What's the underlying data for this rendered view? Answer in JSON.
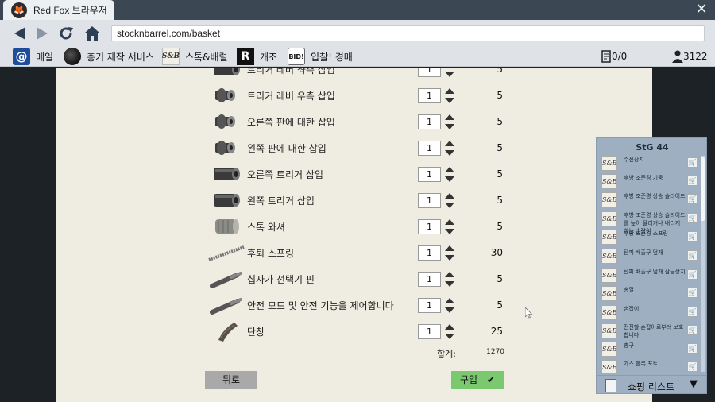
{
  "browser": {
    "tab_title": "Red Fox 브라우저",
    "url": "stocknbarrel.com/basket"
  },
  "bookmarks": [
    {
      "label": "메일",
      "icon": "mail-icon",
      "glyph": "@"
    },
    {
      "label": "총기 제작 서비스",
      "icon": "gun-sphere-icon",
      "glyph": ""
    },
    {
      "label": "스톡&배럴",
      "icon": "stock-and-barrel-logo",
      "glyph": "S&B"
    },
    {
      "label": "개조",
      "icon": "r-logo-icon",
      "glyph": "R"
    },
    {
      "label": "입찰! 경매",
      "icon": "bid-logo-icon",
      "glyph": "BID!"
    }
  ],
  "status": {
    "orders": "0/0",
    "money": "3122"
  },
  "basket": {
    "items": [
      {
        "name": "트리거 레버 좌측 삽입",
        "qty": "1",
        "price": "5",
        "shape": "cylinder"
      },
      {
        "name": "트리거 레버 우측 삽입",
        "qty": "1",
        "price": "5",
        "shape": "bushing"
      },
      {
        "name": "오른쪽 판에 대한 삽입",
        "qty": "1",
        "price": "5",
        "shape": "bushing"
      },
      {
        "name": "왼쪽 판에 대한 삽입",
        "qty": "1",
        "price": "5",
        "shape": "bushing"
      },
      {
        "name": "오른쪽 트리거 삽입",
        "qty": "1",
        "price": "5",
        "shape": "cylinder"
      },
      {
        "name": "왼쪽 트리거 삽입",
        "qty": "1",
        "price": "5",
        "shape": "cylinder"
      },
      {
        "name": "스톡 와셔",
        "qty": "1",
        "price": "5",
        "shape": "washer"
      },
      {
        "name": "후퇴 스프링",
        "qty": "1",
        "price": "30",
        "shape": "spring"
      },
      {
        "name": "십자가 선택기 핀",
        "qty": "1",
        "price": "5",
        "shape": "pin"
      },
      {
        "name": "안전 모드 및 안전 기능을 제어합니다",
        "qty": "1",
        "price": "5",
        "shape": "pin"
      },
      {
        "name": "탄창",
        "qty": "1",
        "price": "25",
        "shape": "magazine"
      }
    ],
    "total_label": "합계:",
    "total_value": "1270",
    "back_label": "뒤로",
    "buy_label": "구입"
  },
  "shopping_list": {
    "title": "StG 44",
    "items": [
      "수신장치",
      "후방 조준경 기둥",
      "후방 조준경 상승 슬라이드",
      "후방 조준경 상승 슬라이드를 높이 올리거나 내리게 하는 손잡이",
      "후방 조준경 스프링",
      "탄피 배출구 덮개",
      "탄피 배출구 덮개 잠금장치",
      "총열",
      "손잡이",
      "전진할 손잡이로부터 보호합니다",
      "총구",
      "가스 블록 포트"
    ],
    "footer_label": "쇼핑 리스트"
  },
  "colors": {
    "titlebar": "#3b4753",
    "toolbar": "#dfe3e8",
    "page_bg": "#efece2",
    "buy_button": "#7bc96f",
    "back_button": "#a9a9a9",
    "panel": "#9fafc2"
  }
}
